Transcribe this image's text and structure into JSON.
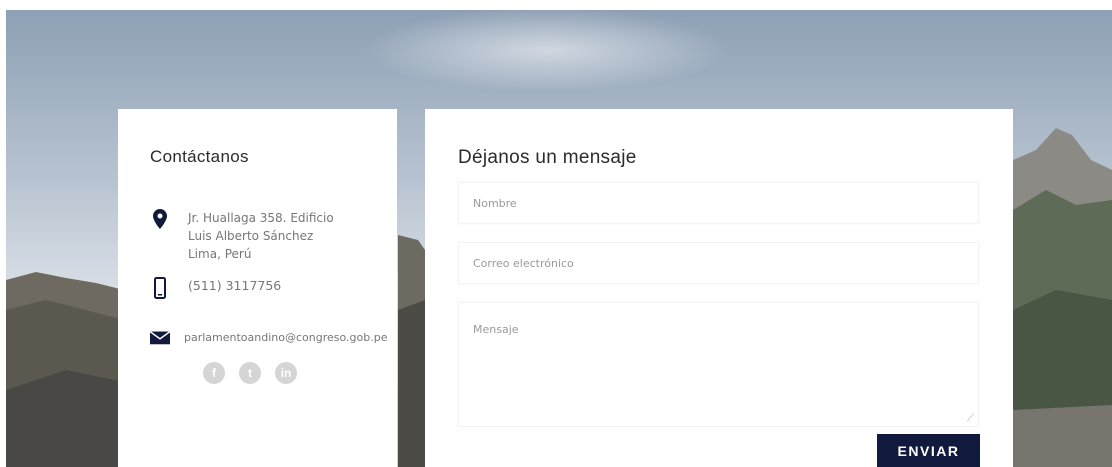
{
  "contact": {
    "title": "Contáctanos",
    "address_line1": "Jr. Huallaga 358. Edificio",
    "address_line2": "Luis Alberto Sánchez",
    "address_line3": "Lima, Perú",
    "phone": "(511) 3117756",
    "email": "parlamentoandino@congreso.gob.pe",
    "social": {
      "facebook": "f",
      "twitter": "t",
      "linkedin": "in"
    }
  },
  "form": {
    "title": "Déjanos un mensaje",
    "name_placeholder": "Nombre",
    "email_placeholder": "Correo electrónico",
    "message_placeholder": "Mensaje",
    "submit_label": "ENVIAR"
  },
  "colors": {
    "button": "#111a3d",
    "icon": "#111a3d"
  }
}
